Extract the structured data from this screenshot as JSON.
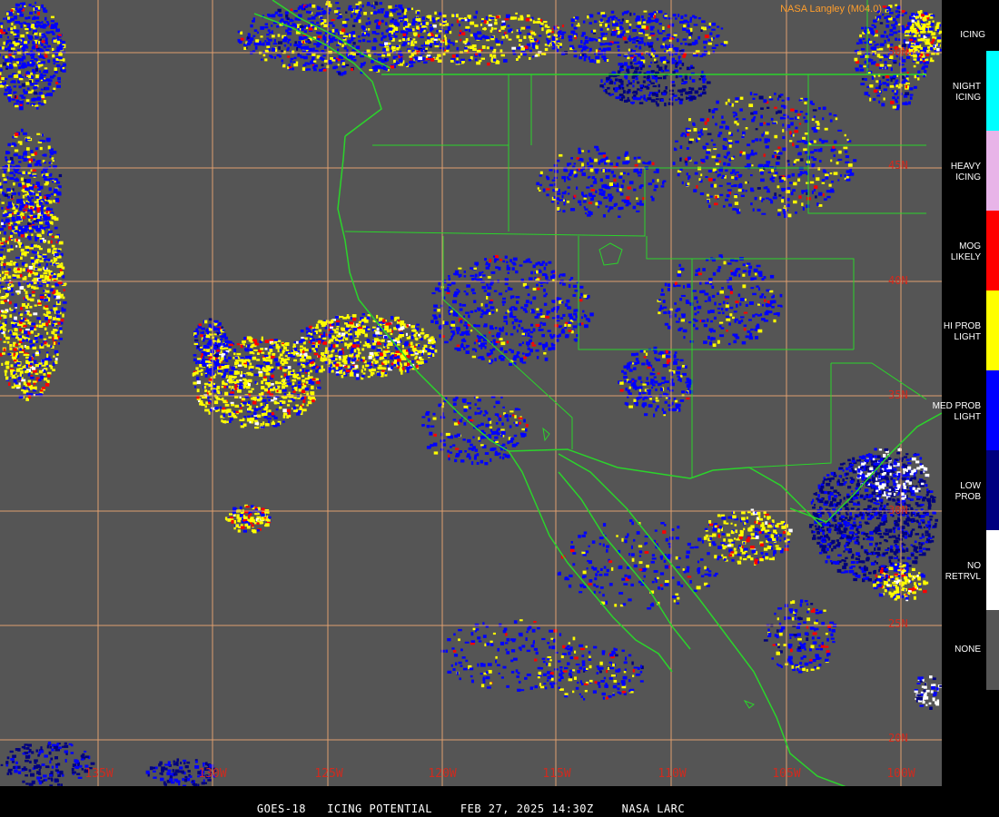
{
  "credit": "NASA Langley (M04.0)",
  "footer": {
    "satellite": "GOES-18",
    "product": "ICING POTENTIAL",
    "datetime": "FEB 27, 2025 14:30Z",
    "agency": "NASA LARC"
  },
  "legend": {
    "title": "ICING",
    "items": [
      {
        "label": "NIGHT\nICING",
        "color": "#00ffff"
      },
      {
        "label": "HEAVY\nICING",
        "color": "#e8b4e8"
      },
      {
        "label": "MOG\nLIKELY",
        "color": "#ff0000"
      },
      {
        "label": "HI PROB\nLIGHT",
        "color": "#ffff00"
      },
      {
        "label": "MED PROB\nLIGHT",
        "color": "#0000ff"
      },
      {
        "label": "LOW\nPROB",
        "color": "#00007f"
      },
      {
        "label": "NO\nRETRVL",
        "color": "#ffffff"
      },
      {
        "label": "NONE",
        "color": "#555555"
      }
    ]
  },
  "grid": {
    "longitudes": [
      "135W",
      "130W",
      "125W",
      "120W",
      "115W",
      "110W",
      "105W",
      "100W"
    ],
    "latitudes": [
      "50N",
      "45N",
      "40N",
      "35N",
      "30N",
      "25N",
      "20N"
    ]
  },
  "colors": {
    "background": "#555555",
    "gridline": "#e0a070",
    "coast": "#2bd42b",
    "label": "#d12a1e"
  }
}
